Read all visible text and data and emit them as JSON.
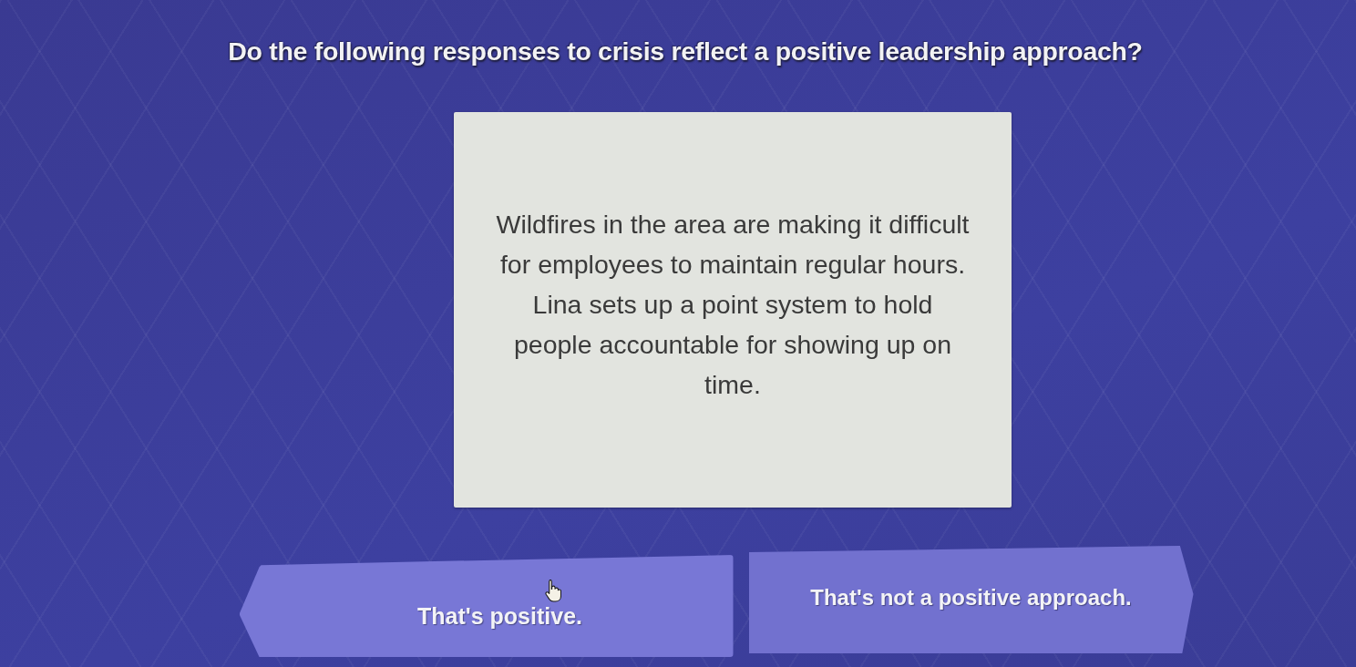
{
  "question": {
    "title": "Do the following responses to crisis reflect a positive leadership approach?"
  },
  "scenario_card": {
    "text": "Wildfires in the area are making it difficult for employees to maintain regular hours. Lina sets up a point system to hold people accountable for showing up on time."
  },
  "answers": [
    {
      "label": "That's positive.",
      "kind": "left",
      "hovered": true
    },
    {
      "label": "That's not a positive approach.",
      "kind": "right",
      "hovered": false
    }
  ]
}
